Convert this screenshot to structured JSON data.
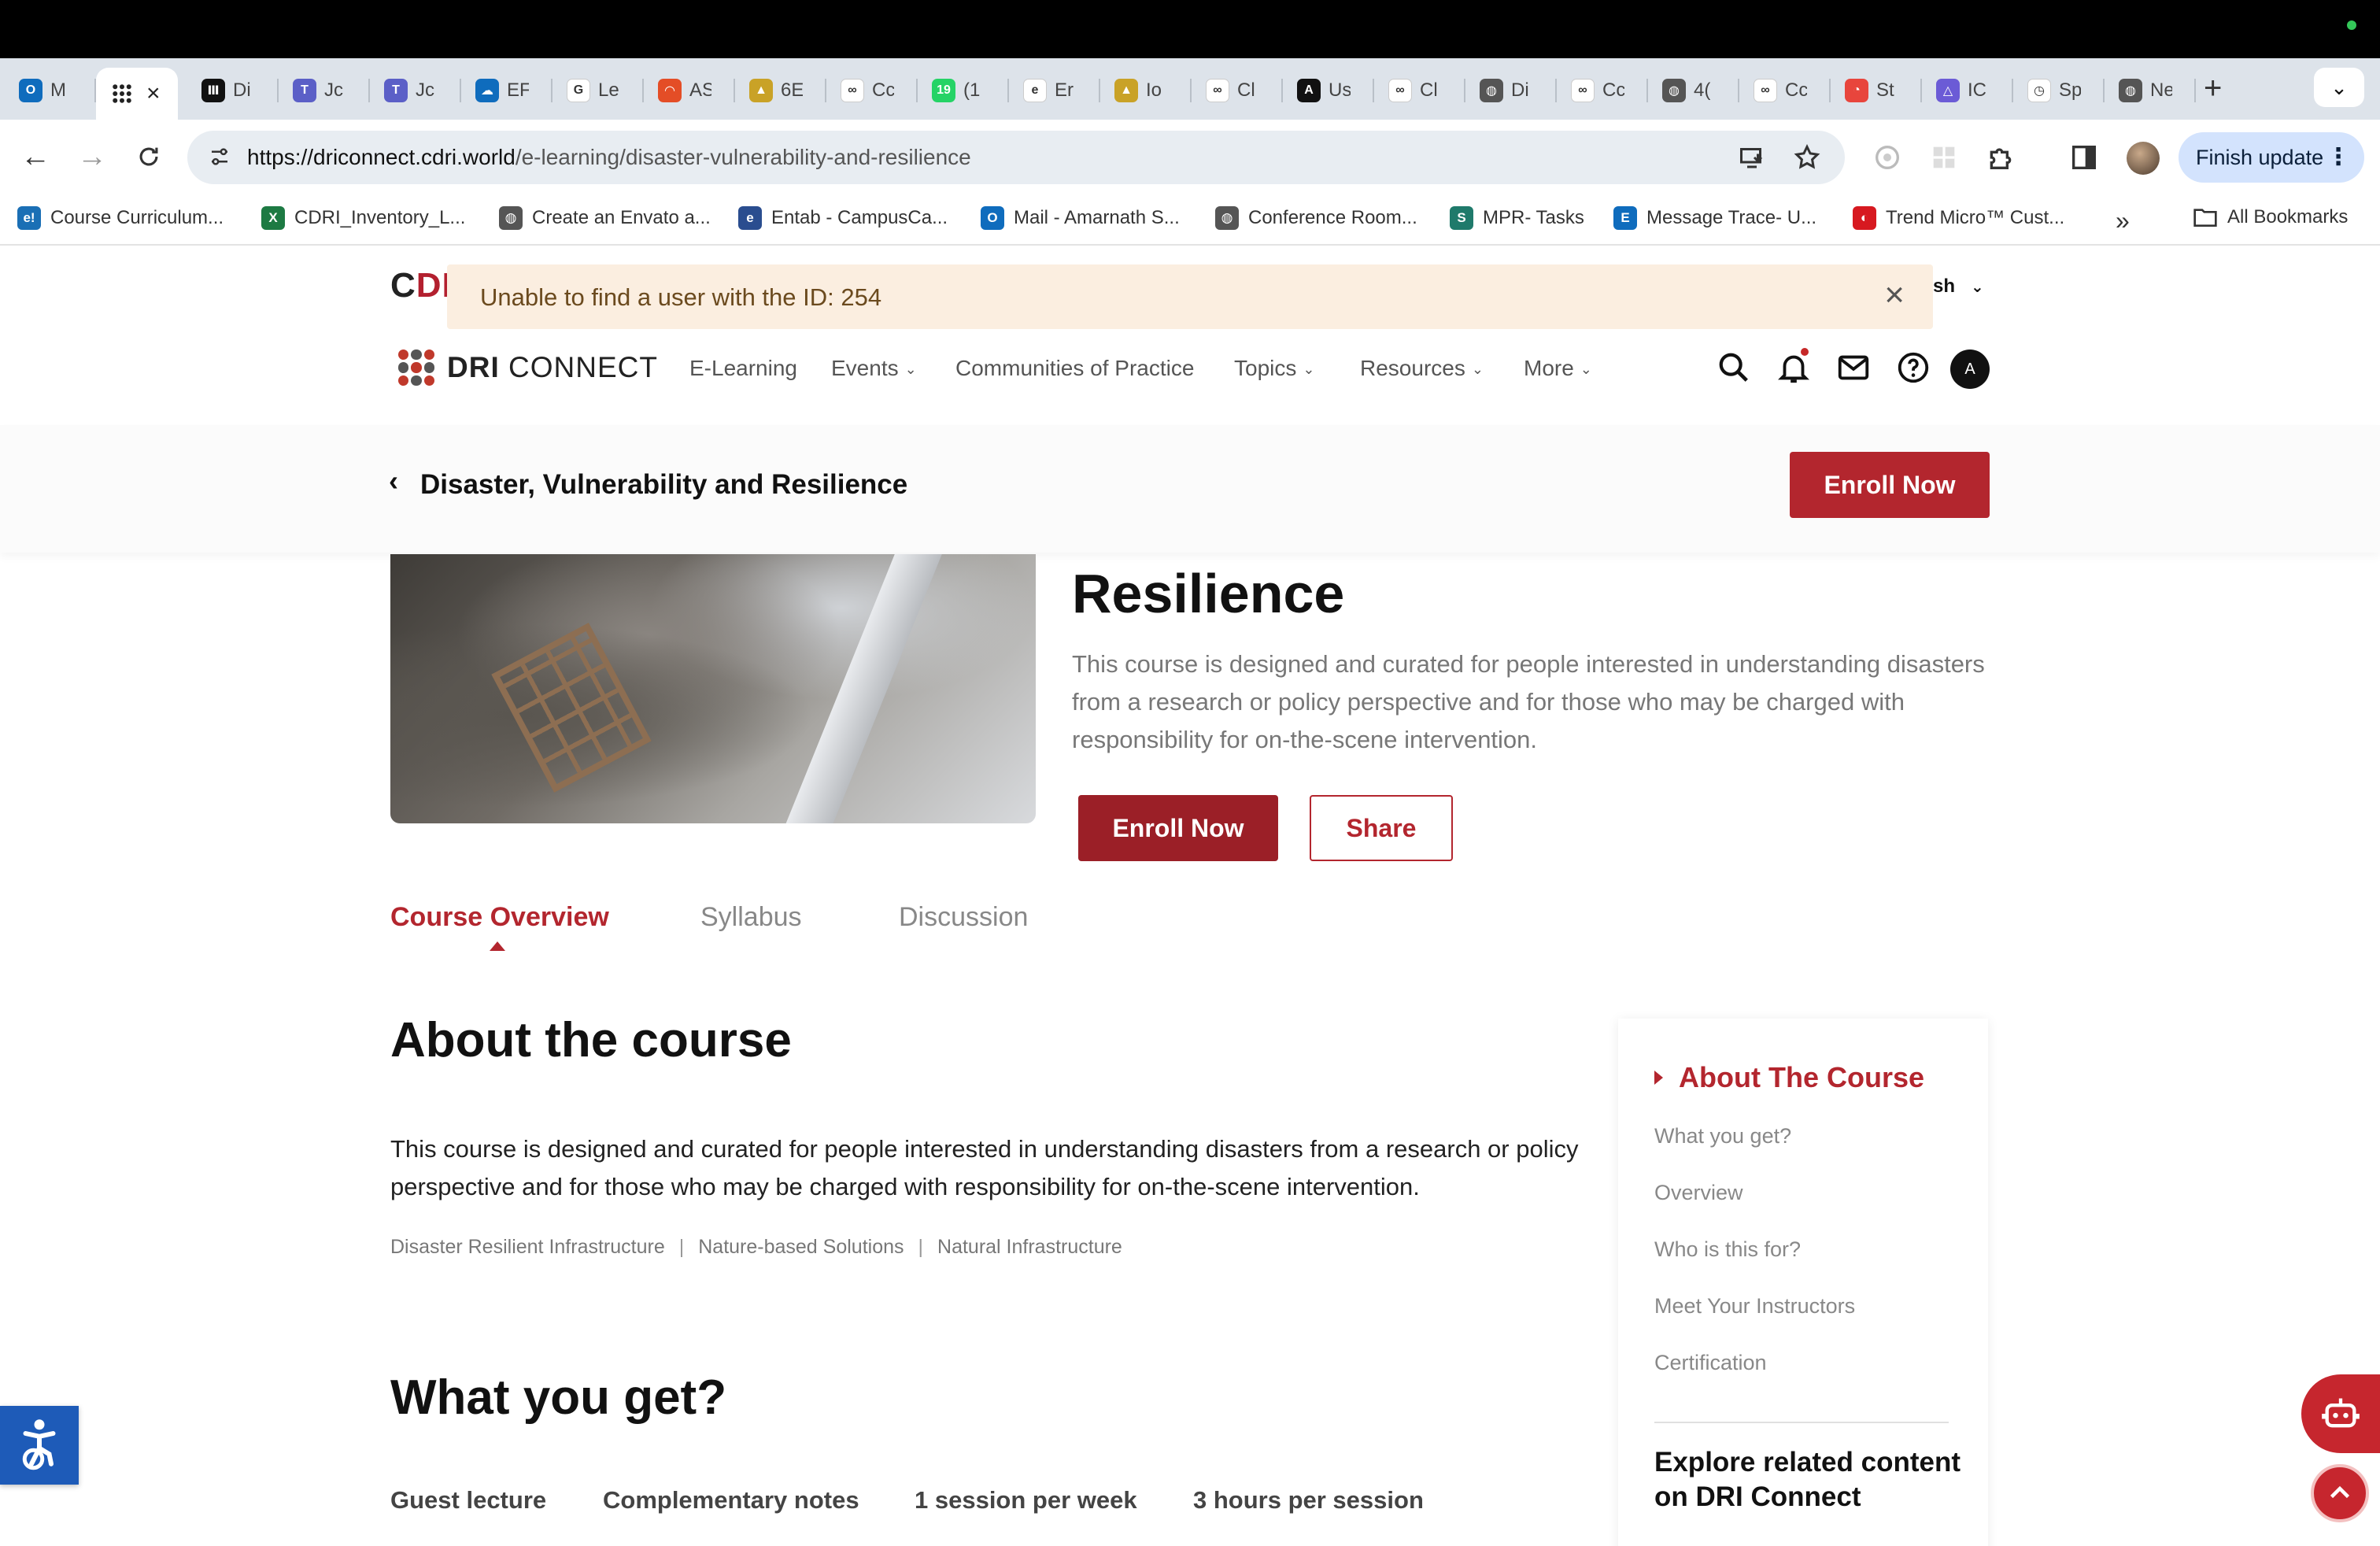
{
  "browser": {
    "tabs": [
      {
        "label": "M",
        "color": "#0f6cbd",
        "glyph": "O"
      },
      {
        "label": "",
        "color": "#ffffff",
        "glyph": "",
        "active": true
      },
      {
        "label": "Di",
        "color": "#111111",
        "glyph": "Ⅲ"
      },
      {
        "label": "Jc",
        "color": "#5b5fc7",
        "glyph": "T"
      },
      {
        "label": "Jc",
        "color": "#5b5fc7",
        "glyph": "T"
      },
      {
        "label": "EF",
        "color": "#0f6cbd",
        "glyph": "☁"
      },
      {
        "label": "Le",
        "color": "#ffffff",
        "glyph": "G"
      },
      {
        "label": "AS",
        "color": "#e44d26",
        "glyph": "◠"
      },
      {
        "label": "6E",
        "color": "#c9a227",
        "glyph": "▲"
      },
      {
        "label": "Cc",
        "color": "#ffffff",
        "glyph": "∞"
      },
      {
        "label": "(1",
        "color": "#25d366",
        "glyph": "19"
      },
      {
        "label": "Er",
        "color": "#ffffff",
        "glyph": "e"
      },
      {
        "label": "Io",
        "color": "#c9a227",
        "glyph": "▲"
      },
      {
        "label": "Cl",
        "color": "#ffffff",
        "glyph": "∞"
      },
      {
        "label": "Us",
        "color": "#111111",
        "glyph": "A"
      },
      {
        "label": "Cl",
        "color": "#ffffff",
        "glyph": "∞"
      },
      {
        "label": "Di",
        "color": "#555555",
        "glyph": "◍"
      },
      {
        "label": "Cc",
        "color": "#ffffff",
        "glyph": "∞"
      },
      {
        "label": "4(",
        "color": "#555555",
        "glyph": "◍"
      },
      {
        "label": "Cc",
        "color": "#ffffff",
        "glyph": "∞"
      },
      {
        "label": "St",
        "color": "#e8453c",
        "glyph": "◔"
      },
      {
        "label": "IC",
        "color": "#6b5bd6",
        "glyph": "△"
      },
      {
        "label": "Sp",
        "color": "#ffffff",
        "glyph": "◷"
      },
      {
        "label": "Ne",
        "color": "#555555",
        "glyph": "◍"
      }
    ],
    "url_host": "https://driconnect.cdri.world",
    "url_path": "/e-learning/disaster-vulnerability-and-resilience",
    "finish_update": "Finish update",
    "bookmarks": [
      {
        "label": "Course Curriculum...",
        "color": "#1a6fb5",
        "glyph": "e!"
      },
      {
        "label": "CDRI_Inventory_L...",
        "color": "#1d7a43",
        "glyph": "X"
      },
      {
        "label": "Create an Envato a...",
        "color": "#555555",
        "glyph": "◍"
      },
      {
        "label": "Entab - CampusCa...",
        "color": "#2a4d8f",
        "glyph": "e"
      },
      {
        "label": "Mail - Amarnath S...",
        "color": "#0f6cbd",
        "glyph": "O"
      },
      {
        "label": "Conference Room...",
        "color": "#555555",
        "glyph": "◍"
      },
      {
        "label": "MPR- Tasks",
        "color": "#1f7a6b",
        "glyph": "S"
      },
      {
        "label": "Message Trace- U...",
        "color": "#0f6cbd",
        "glyph": "E"
      },
      {
        "label": "Trend Micro™ Cust...",
        "color": "#d71920",
        "glyph": "◐"
      }
    ],
    "more_bookmarks": "»",
    "all_bookmarks": "All Bookmarks"
  },
  "site": {
    "logo_prefix": "C",
    "logo_red": "DR",
    "language_suffix": "sh",
    "toast_message": "Unable to find a user with the ID: 254",
    "brand_bold": "DRI",
    "brand_light": "CONNECT",
    "nav": [
      {
        "label": "E-Learning",
        "dropdown": false
      },
      {
        "label": "Events",
        "dropdown": true
      },
      {
        "label": "Communities of Practice",
        "dropdown": false
      },
      {
        "label": "Topics",
        "dropdown": true
      },
      {
        "label": "Resources",
        "dropdown": true
      },
      {
        "label": "More",
        "dropdown": true
      }
    ],
    "user_initial": "A"
  },
  "course": {
    "bar_title": "Disaster, Vulnerability and Resilience",
    "enroll_label": "Enroll Now",
    "share_label": "Share",
    "hero_title_visible": "Resilience",
    "description": "This course is designed and curated for people interested in understanding disasters from a research or policy perspective and for those who may be charged with responsibility for on-the-scene intervention.",
    "tabs": [
      "Course Overview",
      "Syllabus",
      "Discussion"
    ],
    "active_tab": "Course Overview",
    "about_heading": "About the course",
    "about_text": "This course is designed and curated for people interested in understanding disasters from a research or policy perspective and for those who may be charged with responsibility for on-the-scene intervention.",
    "tags": [
      "Disaster Resilient Infrastructure",
      "Nature-based Solutions",
      "Natural Infrastructure"
    ],
    "what_heading": "What you get?",
    "what_items": [
      "Guest lecture",
      "Complementary notes",
      "1 session per week",
      "3 hours per session"
    ]
  },
  "toc": {
    "active": "About The Course",
    "items": [
      "What you get?",
      "Overview",
      "Who is this for?",
      "Meet Your Instructors",
      "Certification"
    ],
    "explore": "Explore related content on DRI Connect"
  },
  "colors": {
    "brand_red": "#b3262e",
    "toast_bg": "#fbeee0",
    "a11y_blue": "#1e5bb8"
  }
}
